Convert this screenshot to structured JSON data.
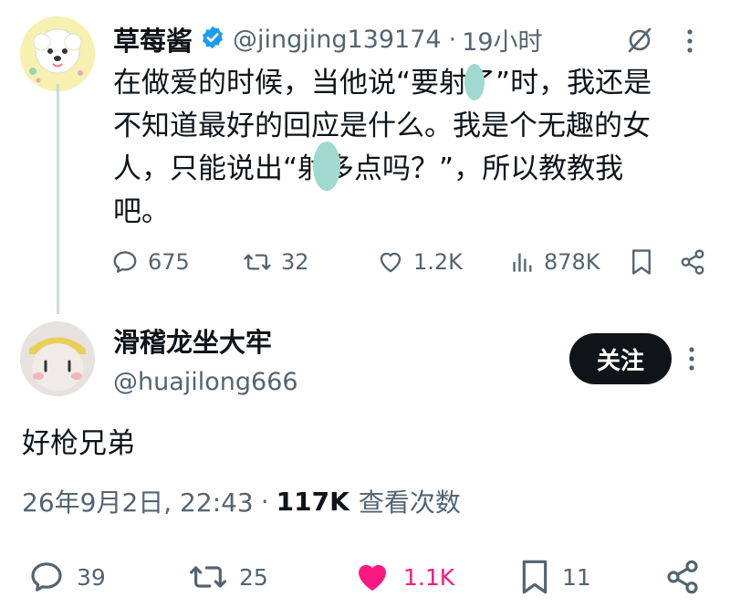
{
  "original_tweet": {
    "author_name": "草莓酱",
    "author_handle": "@jingjing139174",
    "separator": "·",
    "time": "19小时",
    "lines": [
      "在做爱的时候，当他说“要射了”时，我还是",
      "不知道最好的回应是什么。我是个无趣的女",
      "人，只能说出“射多点吗？”，所以教教我",
      "吧。"
    ],
    "stats": {
      "replies": "675",
      "retweets": "32",
      "likes": "1.2K",
      "views": "878K"
    }
  },
  "reply": {
    "author_name": "滑稽龙坐大牢",
    "author_handle": "@huajilong666",
    "follow_label": "关注",
    "text": "好枪兄弟",
    "timestamp": "26年9月2日, 22:43",
    "dot": "·",
    "views_count": "117K",
    "views_label": "查看次数",
    "stats": {
      "replies": "39",
      "retweets": "25",
      "likes": "1.1K",
      "bookmarks": "11"
    },
    "like_color": "#f91880"
  },
  "colors": {
    "verified": "#1d9bf0",
    "secondary_text": "#536471",
    "primary_text": "#0f1419"
  }
}
